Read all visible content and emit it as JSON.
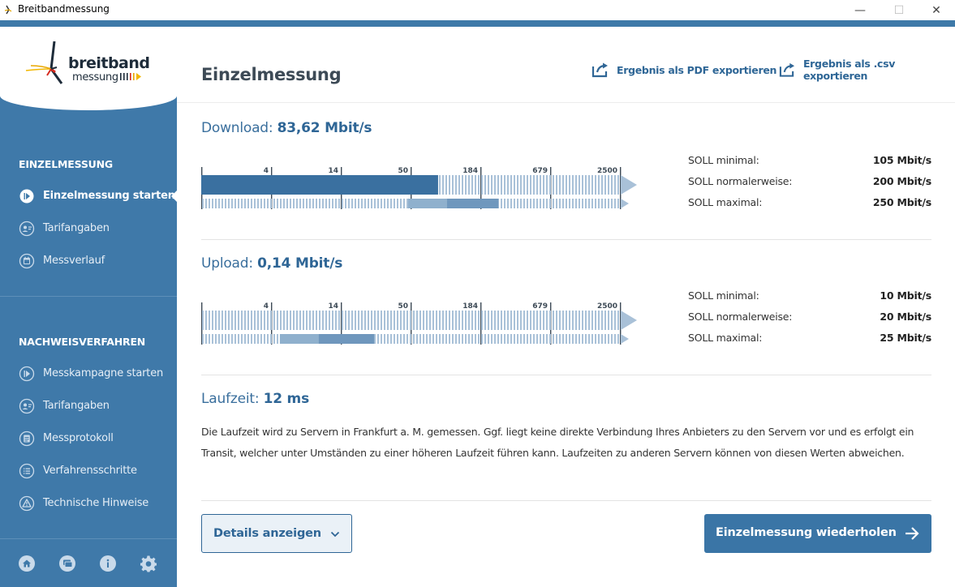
{
  "window": {
    "title": "Breitbandmessung",
    "minimize_glyph": "—",
    "maximize_glyph": "☐",
    "close_glyph": "✕"
  },
  "logo": {
    "line1": "breitband",
    "line2": "messung"
  },
  "sidebar": {
    "section1_heading": "EINZELMESSUNG",
    "section1_items": [
      {
        "label": "Einzelmessung starten",
        "icon": "play-circle-icon",
        "active": true
      },
      {
        "label": "Tarifangaben",
        "icon": "person-card-icon",
        "active": false
      },
      {
        "label": "Messverlauf",
        "icon": "calendar-icon",
        "active": false
      }
    ],
    "section2_heading": "NACHWEISVERFAHREN",
    "section2_items": [
      {
        "label": "Messkampagne starten",
        "icon": "play-circle-icon"
      },
      {
        "label": "Tarifangaben",
        "icon": "person-card-icon"
      },
      {
        "label": "Messprotokoll",
        "icon": "clipboard-icon"
      },
      {
        "label": "Verfahrensschritte",
        "icon": "list-icon"
      },
      {
        "label": "Technische Hinweise",
        "icon": "warning-icon"
      }
    ],
    "bottom_icons": [
      "home-icon",
      "chat-icon",
      "info-icon",
      "settings-icon"
    ]
  },
  "header": {
    "title": "Einzelmessung",
    "export_pdf": "Ergebnis als PDF exportieren",
    "export_csv": "Ergebnis als .csv exportieren"
  },
  "download": {
    "label": "Download:",
    "value": "83,62 Mbit/s",
    "value_mbit": 83.62,
    "soll_min_label": "SOLL minimal:",
    "soll_min_value": "105 Mbit/s",
    "soll_normal_label": "SOLL normalerweise:",
    "soll_normal_value": "200 Mbit/s",
    "soll_max_label": "SOLL maximal:",
    "soll_max_value": "250 Mbit/s",
    "soll_min_mbit": 105,
    "soll_max_mbit": 250
  },
  "upload": {
    "label": "Upload:",
    "value": "0,14 Mbit/s",
    "value_mbit": 0.14,
    "soll_min_label": "SOLL minimal:",
    "soll_min_value": "10 Mbit/s",
    "soll_normal_label": "SOLL normalerweise:",
    "soll_normal_value": "20 Mbit/s",
    "soll_max_label": "SOLL maximal:",
    "soll_max_value": "25 Mbit/s",
    "soll_min_mbit": 10,
    "soll_max_mbit": 25
  },
  "scale_ticks": [
    "4",
    "14",
    "50",
    "184",
    "679",
    "2500"
  ],
  "latency": {
    "label": "Laufzeit:",
    "value": "12 ms",
    "description_line1": "Die Laufzeit wird zu Servern in Frankfurt a. M. gemessen. Ggf. liegt keine direkte Verbindung Ihres Anbieters zu den Servern vor und es erfolgt ein",
    "description_line2": "Transit, welcher unter Umständen zu einer höheren Laufzeit führen kann. Laufzeiten zu anderen Servern können von diesen Werten abweichen."
  },
  "buttons": {
    "details": "Details anzeigen",
    "repeat": "Einzelmessung wiederholen"
  },
  "colors": {
    "sidebar": "#3f79a9",
    "primary": "#2f6696",
    "gauge_fill": "#3a70a0",
    "gauge_stripe": "#a9c1d8",
    "soll_range": "#8fb0cd",
    "soll_min_mark": "#6f97bd"
  }
}
